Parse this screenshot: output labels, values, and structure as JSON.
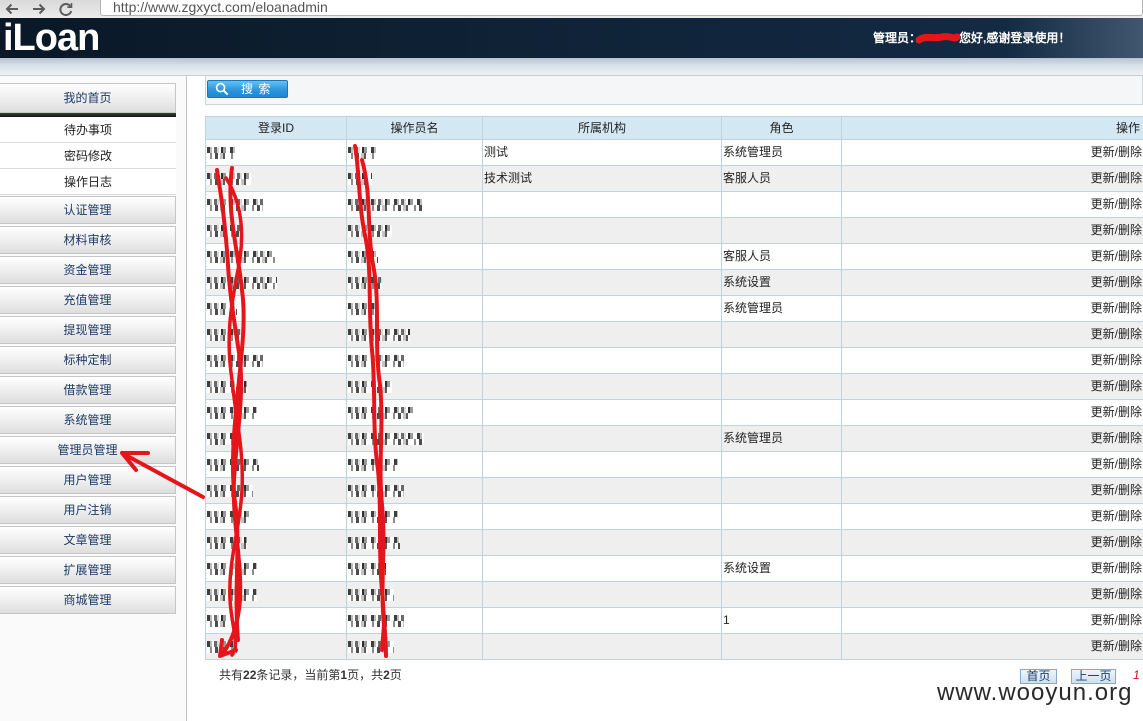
{
  "browser": {
    "url": "http://www.zgxyct.com/eloanadmin",
    "icons": {
      "back": "back-arrow-icon",
      "forward": "forward-arrow-icon",
      "reload": "reload-icon"
    }
  },
  "header": {
    "logo": "iLoan",
    "greeting_prefix": "管理员：",
    "greeting_suffix": "您好,感谢登录使用！"
  },
  "sidebar": {
    "home": "我的首页",
    "quick_links": [
      "待办事项",
      "密码修改",
      "操作日志"
    ],
    "menu": [
      "认证管理",
      "材料审核",
      "资金管理",
      "充值管理",
      "提现管理",
      "标种定制",
      "借款管理",
      "系统管理",
      "管理员管理",
      "用户管理",
      "用户注销",
      "文章管理",
      "扩展管理",
      "商城管理"
    ]
  },
  "search": {
    "button_label": "搜 索",
    "icon": "search-icon"
  },
  "table": {
    "columns": [
      "登录ID",
      "操作员名",
      "所属机构",
      "角色",
      "操作"
    ],
    "row_actions": {
      "update": "更新",
      "separator": "/",
      "delete": "删除"
    },
    "rows": [
      {
        "org": "测试",
        "role": "系统管理员"
      },
      {
        "org": "技术测试",
        "role": "客服人员"
      },
      {},
      {},
      {
        "role": "客服人员"
      },
      {
        "role": "系统设置"
      },
      {
        "role": "系统管理员"
      },
      {},
      {},
      {},
      {},
      {
        "role": "系统管理员"
      },
      {},
      {},
      {},
      {},
      {
        "role": "系统设置"
      },
      {},
      {
        "role": "1"
      },
      {}
    ]
  },
  "pagination": {
    "summary_prefix": "共有",
    "total_records": "22",
    "summary_records": "条记录，当前第",
    "current_page": "1",
    "summary_page": "页，共",
    "total_pages": "2",
    "summary_suffix": "页",
    "first": "首页",
    "prev": "上一页",
    "page_number": "1"
  },
  "watermark": "www.wooyun.org",
  "colors": {
    "header_bg": "#10233a",
    "table_header_bg": "#d3e8f3",
    "search_button": "#2d97dd",
    "menu_text": "#1d3a66",
    "annotation_red": "#e5161b",
    "page_link": "#d21010"
  }
}
